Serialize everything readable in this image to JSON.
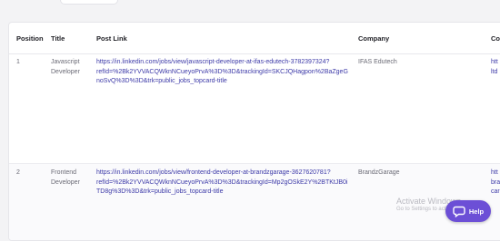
{
  "table": {
    "headers": [
      "Position",
      "Title",
      "Post Link",
      "Company",
      "Co"
    ],
    "rows": [
      {
        "position": "1",
        "title": "Javascript\nDeveloper",
        "post_link": "https://in.linkedin.com/jobs/view/javascript-developer-at-ifas-edutech-3782397324?\nrefId=%2Bk2YVVACQWknNCueyoPrvA%3D%3D&trackingId=SKCJQHagpon%2BaZgeG\nnoSvQ%3D%3D&trk=public_jobs_topcard-title",
        "company": "IFAS Edutech",
        "last_col": "htt\nltd"
      },
      {
        "position": "2",
        "title": "Frontend\nDeveloper",
        "post_link": "https://in.linkedin.com/jobs/view/frontend-developer-at-brandzgarage-3627620781?\nrefId=%2Bk2YVVACQWknNCueyoPrvA%3D%3D&trackingId=Mp2gOSkE2Y%2BTKtJB0i\nTD8g%3D%3D&trk=public_jobs_topcard-title",
        "company": "BrandzGarage",
        "last_col": "htt\nbra\ncar"
      }
    ]
  },
  "help_widget": {
    "label": "Help",
    "icon": "chat-bubble-icon",
    "color": "#6c4fd6"
  },
  "watermark": {
    "title": "Activate Windows",
    "subtitle": "Go to Settings to activate Windows."
  },
  "colors": {
    "link": "#3d3aa8",
    "text_muted": "#6b6b76",
    "header_text": "#1e1e24",
    "background": "#f3f3f5"
  }
}
